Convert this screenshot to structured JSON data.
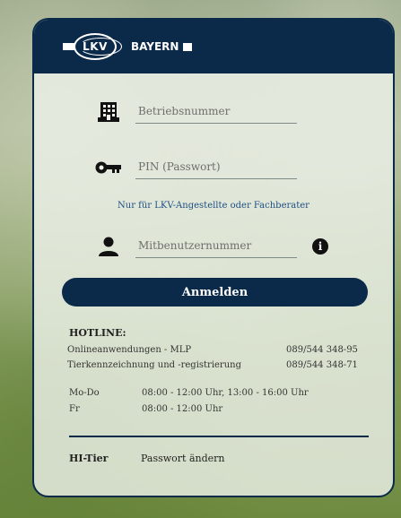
{
  "header": {
    "logo_text": "LKV",
    "brand_text": "BAYERN"
  },
  "form": {
    "betriebsnummer_placeholder": "Betriebsnummer",
    "pin_placeholder": "PIN (Passwort)",
    "staff_link": "Nur für LKV-Angestellte oder Fachberater",
    "mitbenutzer_placeholder": "Mitbenutzernummer",
    "info_glyph": "i",
    "login_label": "Anmelden"
  },
  "hotline": {
    "title": "HOTLINE:",
    "lines": [
      {
        "label": "Onlineanwendungen - MLP",
        "phone": "089/544 348-95"
      },
      {
        "label": "Tierkennzeichnung und -registrierung",
        "phone": "089/544 348-71"
      }
    ],
    "hours": [
      {
        "days": "Mo-Do",
        "time": "08:00 - 12:00 Uhr, 13:00 - 16:00 Uhr"
      },
      {
        "days": "Fr",
        "time": "08:00 - 12:00 Uhr"
      }
    ]
  },
  "footer": {
    "hi_tier": "HI-Tier",
    "change_password": "Passwort ändern"
  },
  "icons": [
    "building-icon",
    "key-icon",
    "user-icon",
    "info-icon"
  ]
}
